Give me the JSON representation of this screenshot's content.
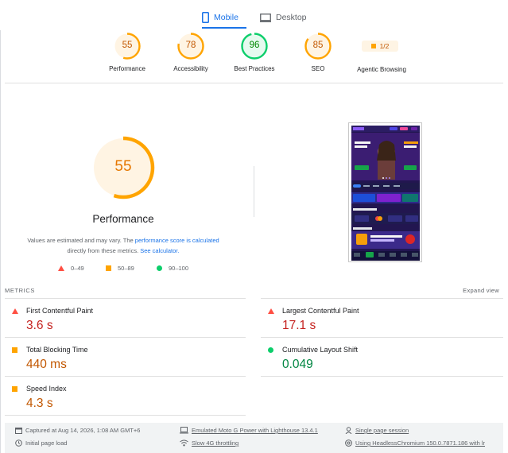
{
  "tabs": {
    "mobile": "Mobile",
    "desktop": "Desktop"
  },
  "colors": {
    "orange": "#ffa400",
    "green": "#0cce6b",
    "red": "#ff4e42",
    "blue": "#1a73e8"
  },
  "categories": [
    {
      "score": "55",
      "label": "Performance",
      "fraction": 0.55,
      "status": "orange"
    },
    {
      "score": "78",
      "label": "Accessibility",
      "fraction": 0.78,
      "status": "orange"
    },
    {
      "score": "96",
      "label": "Best Practices",
      "fraction": 0.96,
      "status": "green"
    },
    {
      "score": "85",
      "label": "SEO",
      "fraction": 0.85,
      "status": "orange"
    }
  ],
  "agentic": {
    "value": "1/2",
    "label": "Agentic Browsing"
  },
  "performance": {
    "score": "55",
    "fraction": 0.55,
    "title": "Performance",
    "note_prefix": "Values are estimated and may vary. The ",
    "note_link1": "performance score is calculated",
    "note_middle": " directly from these metrics. ",
    "note_link2": "See calculator.",
    "legend": [
      "0–49",
      "50–89",
      "90–100"
    ]
  },
  "metrics": {
    "header": "METRICS",
    "expand": "Expand view",
    "items": [
      {
        "name": "First Contentful Paint",
        "value": "3.6 s",
        "status": "red"
      },
      {
        "name": "Largest Contentful Paint",
        "value": "17.1 s",
        "status": "red"
      },
      {
        "name": "Total Blocking Time",
        "value": "440 ms",
        "status": "orange"
      },
      {
        "name": "Cumulative Layout Shift",
        "value": "0.049",
        "status": "green"
      },
      {
        "name": "Speed Index",
        "value": "4.3 s",
        "status": "orange"
      }
    ]
  },
  "footer": {
    "captured": "Captured at Aug 14, 2026, 1:08 AM GMT+6",
    "load": "Initial page load",
    "device": "Emulated Moto G Power with Lighthouse 13.4.1",
    "throttling": "Slow 4G throttling",
    "session": "Single page session",
    "browser": "Using HeadlessChromium 150.0.7871.186 with lr"
  }
}
